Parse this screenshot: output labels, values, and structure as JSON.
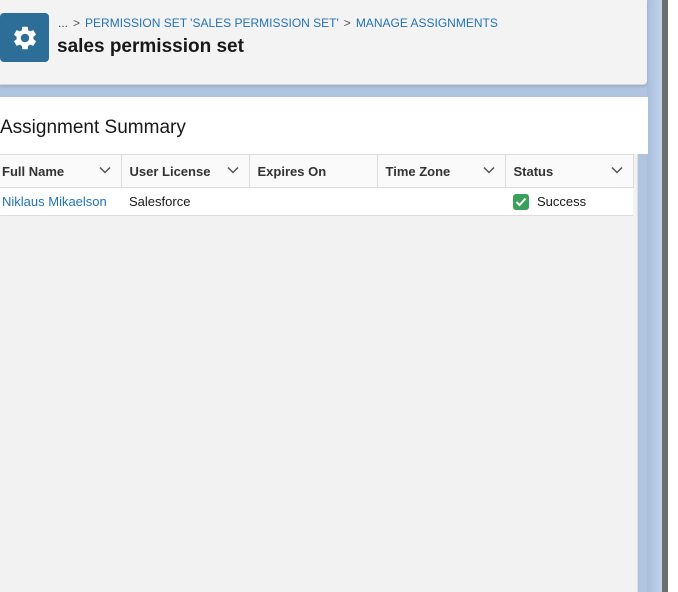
{
  "header": {
    "breadcrumb": {
      "ellipsis": "...",
      "separator": ">",
      "items": [
        "PERMISSION SET 'SALES PERMISSION SET'",
        "MANAGE ASSIGNMENTS"
      ]
    },
    "title": "sales permission set",
    "icon": "gear-icon",
    "icon_color": "#2c6e97"
  },
  "section": {
    "title": "Assignment Summary"
  },
  "table": {
    "columns": [
      {
        "label": "Full Name"
      },
      {
        "label": "User License"
      },
      {
        "label": "Expires On"
      },
      {
        "label": "Time Zone"
      },
      {
        "label": "Status"
      }
    ],
    "rows": [
      {
        "full_name": "Niklaus Mikaelson",
        "user_license": "Salesforce",
        "expires_on": "",
        "time_zone": "",
        "status": "Success"
      }
    ]
  },
  "colors": {
    "link": "#2273b5",
    "success": "#3aa15a"
  }
}
